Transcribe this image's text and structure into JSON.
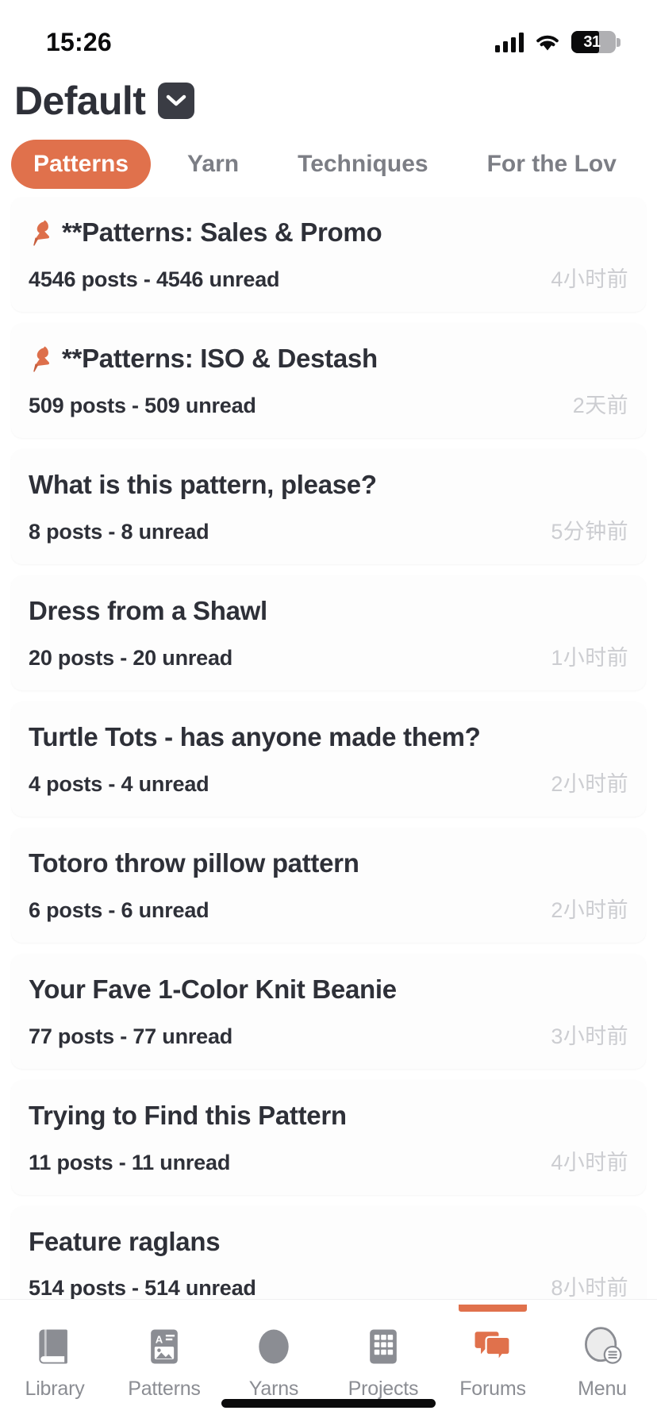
{
  "status_bar": {
    "time": "15:26",
    "battery_percent": "31",
    "battery_level": 31,
    "signal_icon": "cellular-signal-icon",
    "wifi_icon": "wifi-icon",
    "battery_icon": "battery-icon"
  },
  "header": {
    "title": "Default",
    "dropdown_icon": "chevron-down-icon"
  },
  "tabs": [
    {
      "label": "Patterns",
      "active": true
    },
    {
      "label": "Yarn",
      "active": false
    },
    {
      "label": "Techniques",
      "active": false
    },
    {
      "label": "For the Lov",
      "active": false
    }
  ],
  "threads": [
    {
      "pinned": true,
      "pin_icon": "pushpin-icon",
      "title": "**Patterns: Sales & Promo",
      "counts": "4546 posts - 4546 unread",
      "time": "4小时前"
    },
    {
      "pinned": true,
      "pin_icon": "pushpin-icon",
      "title": "**Patterns: ISO & Destash",
      "counts": "509 posts - 509 unread",
      "time": "2天前"
    },
    {
      "pinned": false,
      "title": "What is this pattern, please?",
      "counts": "8 posts - 8 unread",
      "time": "5分钟前"
    },
    {
      "pinned": false,
      "title": "Dress from a Shawl",
      "counts": "20 posts - 20 unread",
      "time": "1小时前"
    },
    {
      "pinned": false,
      "title": "Turtle Tots - has anyone made them?",
      "counts": "4 posts - 4 unread",
      "time": "2小时前"
    },
    {
      "pinned": false,
      "title": "Totoro throw pillow pattern",
      "counts": "6 posts - 6 unread",
      "time": "2小时前"
    },
    {
      "pinned": false,
      "title": "Your Fave 1-Color Knit Beanie",
      "counts": "77 posts - 77 unread",
      "time": "3小时前"
    },
    {
      "pinned": false,
      "title": "Trying to Find this Pattern",
      "counts": "11 posts - 11 unread",
      "time": "4小时前"
    },
    {
      "pinned": false,
      "title": "Feature raglans",
      "counts": "514 posts - 514 unread",
      "time": "8小时前"
    }
  ],
  "bottom_nav": [
    {
      "label": "Library",
      "icon": "book-icon",
      "active": false
    },
    {
      "label": "Patterns",
      "icon": "pattern-card-icon",
      "active": false
    },
    {
      "label": "Yarns",
      "icon": "yarn-ball-icon",
      "active": false
    },
    {
      "label": "Projects",
      "icon": "grid-projects-icon",
      "active": false
    },
    {
      "label": "Forums",
      "icon": "speech-bubbles-icon",
      "active": true
    },
    {
      "label": "Menu",
      "icon": "avatar-menu-icon",
      "active": false
    }
  ],
  "colors": {
    "accent": "#e0714c",
    "text_primary": "#2e3038",
    "text_muted": "#8b8d93",
    "time_muted": "#cccdd1",
    "card_bg": "#fdfdfd",
    "page_bg": "#ffffff"
  }
}
